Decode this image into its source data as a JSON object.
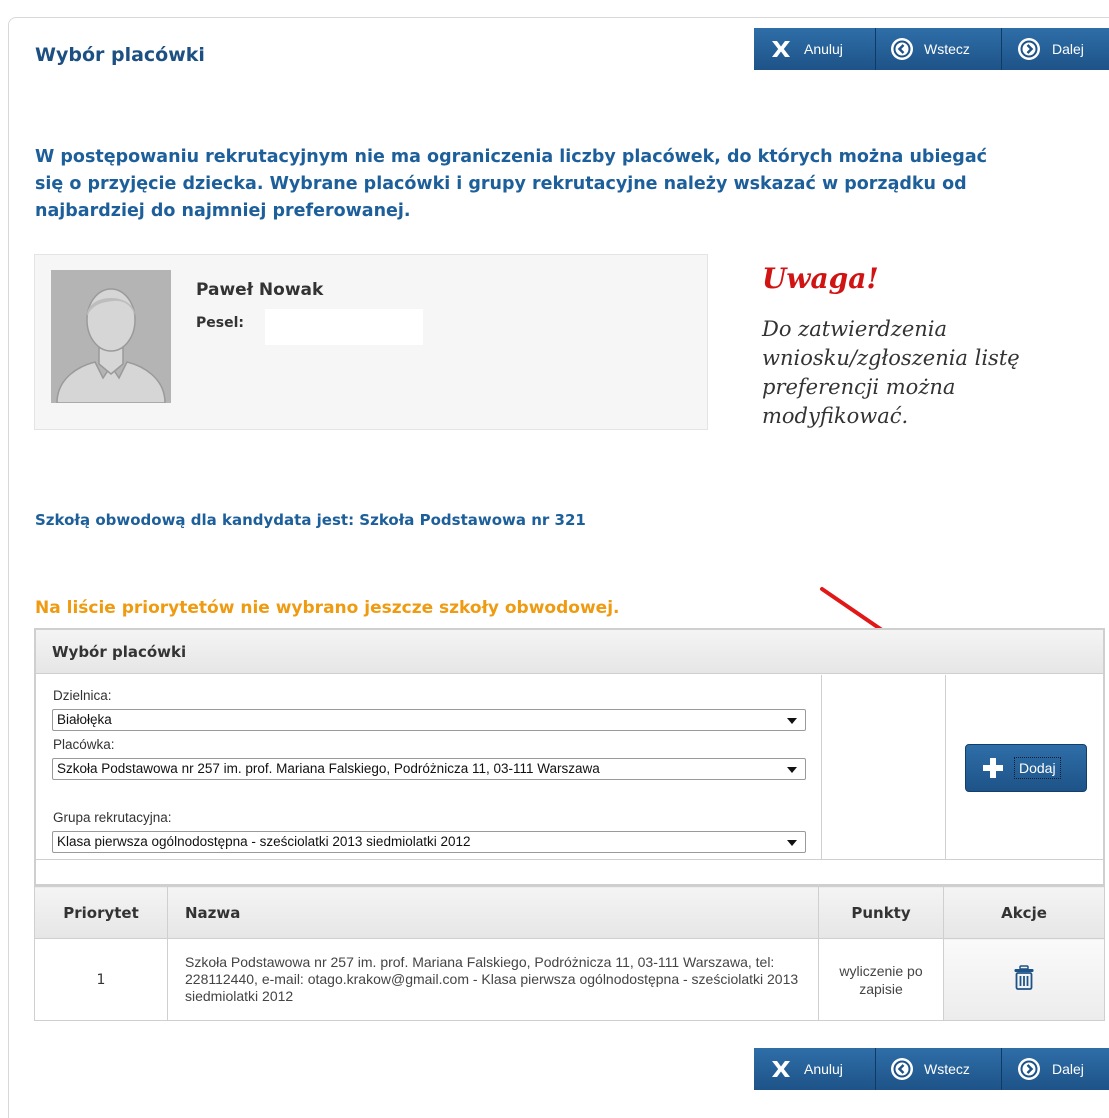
{
  "header": {
    "title": "Wybór placówki"
  },
  "nav": {
    "cancel_label": "Anuluj",
    "back_label": "Wstecz",
    "next_label": "Dalej"
  },
  "intro": {
    "text": "W postępowaniu rekrutacyjnym nie ma ograniczenia liczby placówek, do których można ubiegać się o przyjęcie dziecka. Wybrane placówki i grupy rekrutacyjne należy wskazać w porządku od najbardziej do najmniej preferowanej."
  },
  "child": {
    "name": "Paweł Nowak",
    "pesel_label": "Pesel:",
    "pesel_value": ""
  },
  "warning": {
    "title": "Uwaga!",
    "text": "Do zatwierdzenia wniosku/zgłoszenia listę preferencji można modyfikować."
  },
  "district_school": {
    "text": "Szkołą obwodową dla kandydata jest: Szkoła Podstawowa nr 321"
  },
  "priority_warning": {
    "text": "Na liście priorytetów nie wybrano jeszcze szkoły obwodowej."
  },
  "selection": {
    "title": "Wybór placówki",
    "district_label": "Dzielnica:",
    "district_value": "Białołęka",
    "facility_label": "Placówka:",
    "facility_value": "Szkoła Podstawowa nr 257 im. prof. Mariana Falskiego, Podróżnicza 11, 03-111 Warszawa",
    "group_label": "Grupa rekrutacyjna:",
    "group_value": "Klasa pierwsza ogólnodostępna - sześciolatki 2013 siedmiolatki 2012",
    "add_label": "Dodaj"
  },
  "table": {
    "headers": {
      "priority": "Priorytet",
      "name": "Nazwa",
      "points": "Punkty",
      "actions": "Akcje"
    },
    "rows": [
      {
        "priority": "1",
        "name": "Szkoła Podstawowa nr 257 im. prof. Mariana Falskiego, Podróżnicza 11, 03-111 Warszawa, tel: 228112440, e-mail: otago.krakow@gmail.com - Klasa pierwsza ogólnodostępna - sześciolatki 2013 siedmiolatki 2012",
        "points": "wyliczenie po zapisie",
        "action_icon": "trash-icon"
      }
    ]
  },
  "colors": {
    "primary": "#1d5388",
    "title": "#1c4f82",
    "warning_red": "#d01414",
    "warning_orange": "#ef9b12"
  }
}
